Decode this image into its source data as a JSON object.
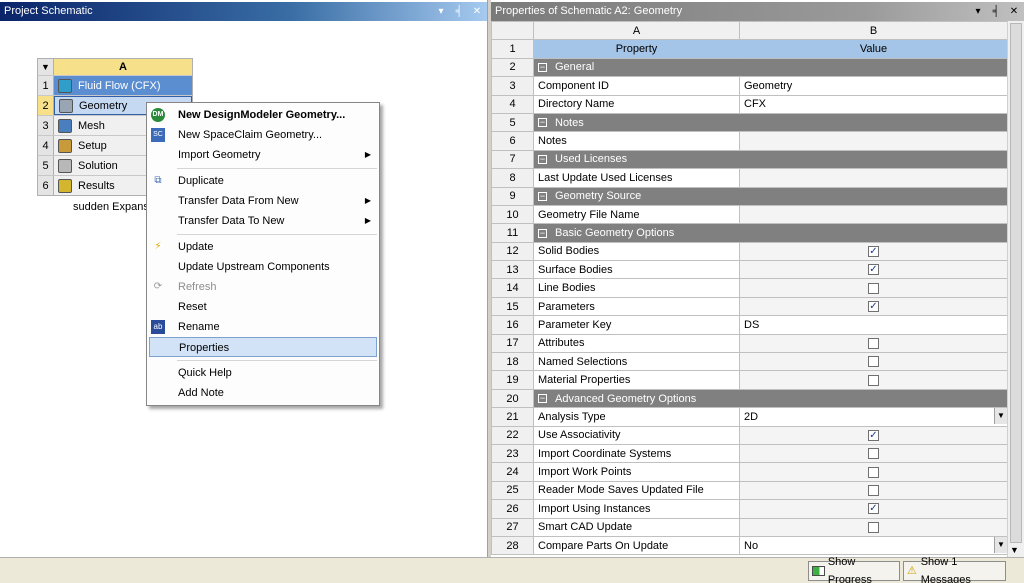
{
  "left_panel": {
    "title": "Project Schematic"
  },
  "right_panel": {
    "title": "Properties of Schematic A2: Geometry"
  },
  "panel_icons": {
    "dropdown": "▾",
    "pin": "╡",
    "close": "✕"
  },
  "system": {
    "column_label": "A",
    "caption": "sudden Expansi",
    "rows": [
      {
        "num": "1",
        "label": "Fluid Flow (CFX)",
        "icon": "cfx-icon",
        "color": "#2f9ec8"
      },
      {
        "num": "2",
        "label": "Geometry",
        "icon": "geometry-icon",
        "color": "#9aa5b4"
      },
      {
        "num": "3",
        "label": "Mesh",
        "icon": "mesh-icon",
        "color": "#4a7fbf"
      },
      {
        "num": "4",
        "label": "Setup",
        "icon": "setup-icon",
        "color": "#c89a3a"
      },
      {
        "num": "5",
        "label": "Solution",
        "icon": "solution-icon",
        "color": "#b8b8b8"
      },
      {
        "num": "6",
        "label": "Results",
        "icon": "results-icon",
        "color": "#d4b52e"
      }
    ]
  },
  "context_menu": {
    "items": [
      {
        "label": "New DesignModeler Geometry...",
        "icon": "designmodeler-icon",
        "glyph": "DM",
        "bold": true
      },
      {
        "label": "New SpaceClaim Geometry...",
        "icon": "spaceclaim-icon",
        "glyph": "SC"
      },
      {
        "label": "Import Geometry",
        "submenu": true
      },
      {
        "separator": true
      },
      {
        "label": "Duplicate",
        "icon": "duplicate-icon",
        "glyph": "⧉"
      },
      {
        "label": "Transfer Data From New",
        "submenu": true
      },
      {
        "label": "Transfer Data To New",
        "submenu": true
      },
      {
        "separator": true
      },
      {
        "label": "Update",
        "icon": "update-lightning-icon",
        "glyph": "⚡"
      },
      {
        "label": "Update Upstream Components"
      },
      {
        "label": "Refresh",
        "icon": "refresh-icon",
        "glyph": "⟳",
        "disabled": true
      },
      {
        "label": "Reset"
      },
      {
        "label": "Rename",
        "icon": "rename-icon",
        "glyph": "ab"
      },
      {
        "label": "Properties",
        "highlighted": true
      },
      {
        "separator": true
      },
      {
        "label": "Quick Help"
      },
      {
        "label": "Add Note"
      }
    ]
  },
  "properties": {
    "col_a": "A",
    "col_b": "B",
    "rows": [
      {
        "num": "1",
        "type": "colhead",
        "a": "Property",
        "b": "Value"
      },
      {
        "num": "2",
        "type": "group",
        "a": "General"
      },
      {
        "num": "3",
        "type": "text",
        "a": "Component ID",
        "b": "Geometry"
      },
      {
        "num": "4",
        "type": "text",
        "a": "Directory Name",
        "b": "CFX"
      },
      {
        "num": "5",
        "type": "group",
        "a": "Notes"
      },
      {
        "num": "6",
        "type": "text",
        "a": "Notes",
        "b": ""
      },
      {
        "num": "7",
        "type": "group",
        "a": "Used Licenses"
      },
      {
        "num": "8",
        "type": "text",
        "a": "Last Update Used Licenses",
        "b": ""
      },
      {
        "num": "9",
        "type": "group",
        "a": "Geometry Source"
      },
      {
        "num": "10",
        "type": "text",
        "a": "Geometry File Name",
        "b": ""
      },
      {
        "num": "11",
        "type": "group",
        "a": "Basic Geometry Options"
      },
      {
        "num": "12",
        "type": "check",
        "a": "Solid Bodies",
        "checked": true
      },
      {
        "num": "13",
        "type": "check",
        "a": "Surface Bodies",
        "checked": true
      },
      {
        "num": "14",
        "type": "check",
        "a": "Line Bodies",
        "checked": false
      },
      {
        "num": "15",
        "type": "check",
        "a": "Parameters",
        "checked": true
      },
      {
        "num": "16",
        "type": "text",
        "a": "Parameter Key",
        "b": "DS"
      },
      {
        "num": "17",
        "type": "check",
        "a": "Attributes",
        "checked": false
      },
      {
        "num": "18",
        "type": "check",
        "a": "Named Selections",
        "checked": false
      },
      {
        "num": "19",
        "type": "check",
        "a": "Material Properties",
        "checked": false
      },
      {
        "num": "20",
        "type": "group",
        "a": "Advanced Geometry Options"
      },
      {
        "num": "21",
        "type": "dropdown",
        "a": "Analysis Type",
        "b": "2D"
      },
      {
        "num": "22",
        "type": "check",
        "a": "Use Associativity",
        "checked": true
      },
      {
        "num": "23",
        "type": "check",
        "a": "Import Coordinate Systems",
        "checked": false
      },
      {
        "num": "24",
        "type": "check",
        "a": "Import Work Points",
        "checked": false
      },
      {
        "num": "25",
        "type": "check",
        "a": "Reader Mode Saves Updated File",
        "checked": false
      },
      {
        "num": "26",
        "type": "check",
        "a": "Import Using Instances",
        "checked": true
      },
      {
        "num": "27",
        "type": "check",
        "a": "Smart CAD Update",
        "checked": false
      },
      {
        "num": "28",
        "type": "dropdown",
        "a": "Compare Parts On Update",
        "b": "No"
      }
    ]
  },
  "status_bar": {
    "show_progress": "Show Progress",
    "show_messages": "Show 1 Messages"
  }
}
